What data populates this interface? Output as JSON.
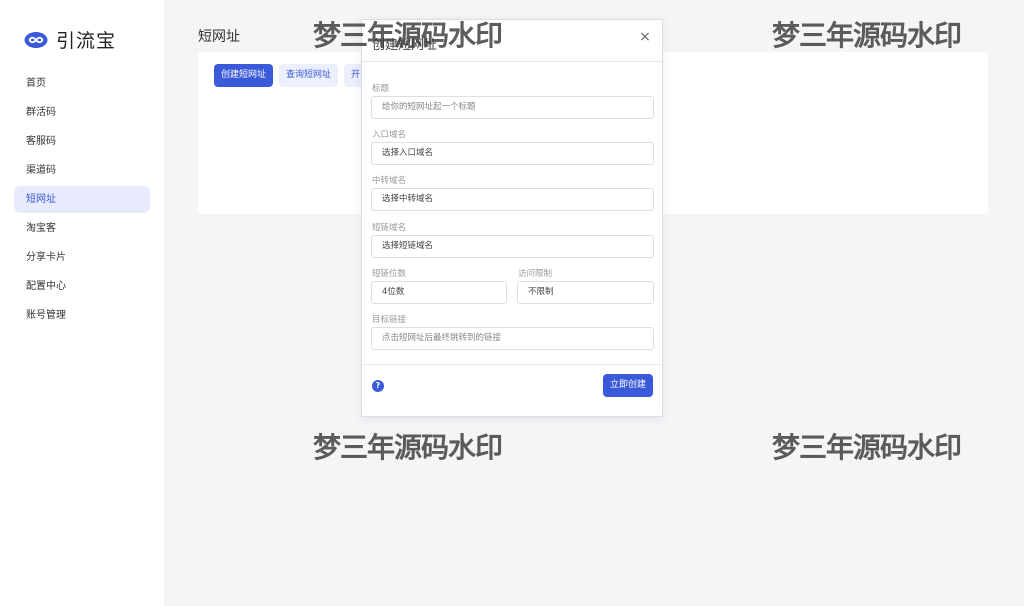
{
  "app": {
    "name": "引流宝"
  },
  "sidebar": {
    "items": [
      {
        "label": "首页"
      },
      {
        "label": "群活码"
      },
      {
        "label": "客服码"
      },
      {
        "label": "渠道码"
      },
      {
        "label": "短网址",
        "active": true
      },
      {
        "label": "淘宝客"
      },
      {
        "label": "分享卡片"
      },
      {
        "label": "配置中心"
      },
      {
        "label": "账号管理"
      }
    ]
  },
  "page": {
    "title": "短网址",
    "toolbar": {
      "create_label": "创建短网址",
      "query_label": "查询短网址",
      "third_label": "开"
    }
  },
  "modal": {
    "title": "创建短网址",
    "close_glyph": "×",
    "fields": {
      "title": {
        "label": "标题",
        "placeholder": "给你的短网址起一个标题"
      },
      "entry_domain": {
        "label": "入口域名",
        "value": "选择入口域名"
      },
      "relay_domain": {
        "label": "中转域名",
        "value": "选择中转域名"
      },
      "short_domain": {
        "label": "短链域名",
        "value": "选择短链域名"
      },
      "digits": {
        "label": "短链位数",
        "value": "4位数"
      },
      "limit": {
        "label": "访问限制",
        "value": "不限制"
      },
      "target": {
        "label": "目标链接",
        "placeholder": "点击短网址后最终跳转到的链接"
      }
    },
    "help_glyph": "?",
    "submit_label": "立即创建"
  },
  "watermark": {
    "text": "梦三年源码水印"
  },
  "colors": {
    "accent": "#3a5ad9",
    "accent_light": "#eceffc",
    "background": "#f4f5f7"
  },
  "icons": {
    "logo": "infinity-logo-icon",
    "close": "close-icon",
    "help": "help-icon"
  }
}
